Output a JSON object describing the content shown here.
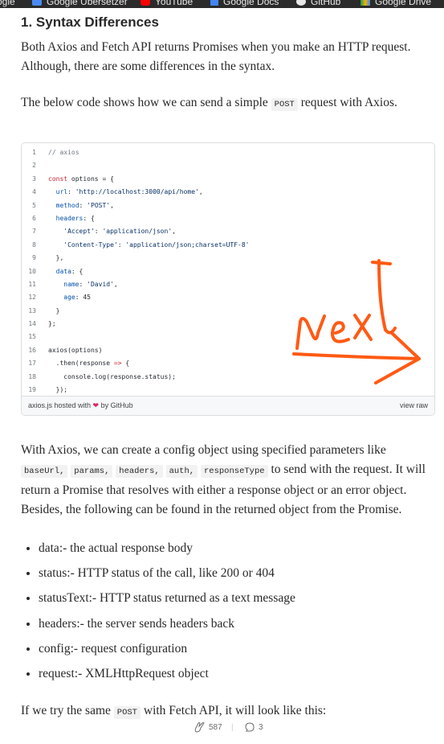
{
  "bookmarks": [
    {
      "label": "ogle",
      "icon": "none"
    },
    {
      "label": "Google Übersetzer",
      "icon": "google-translate-icon"
    },
    {
      "label": "YouTube",
      "icon": "youtube-icon"
    },
    {
      "label": "Google Docs",
      "icon": "google-docs-icon"
    },
    {
      "label": "GitHub",
      "icon": "github-icon"
    },
    {
      "label": "Google Drive",
      "icon": "google-drive-icon"
    }
  ],
  "article": {
    "heading": "1. Syntax Differences",
    "p1": "Both Axios and Fetch API returns Promises when you make an HTTP request. Although, there are some differences in the syntax.",
    "p2_before": "The below code shows how we can send a simple ",
    "p2_code": "POST",
    "p2_after": " request with Axios.",
    "p3_a": "With Axios, we can create a config object using specified parameters like",
    "p3_codes": [
      "baseUrl,",
      "params,",
      "headers,",
      "auth,",
      "responseType"
    ],
    "p3_b": " to send with the request. It will return a Promise that resolves with either a response object or an error object. Besides, the following can be found in the returned object from the Promise.",
    "bullets": [
      "data:- the actual response body",
      "status:- HTTP status of the call, like 200 or 404",
      "statusText:- HTTP status returned as a text message",
      "headers:- the server sends headers back",
      "config:- request configuration",
      "request:- XMLHttpRequest object"
    ],
    "p4_before": "If we try the same ",
    "p4_code": "POST",
    "p4_after": " with Fetch API, it will look like this:"
  },
  "gist": {
    "lines": [
      "// axios",
      "",
      "const options = {",
      "  url: 'http://localhost:3000/api/home',",
      "  method: 'POST',",
      "  headers: {",
      "    'Accept': 'application/json',",
      "    'Content-Type': 'application/json;charset=UTF-8'",
      "  },",
      "  data: {",
      "    name: 'David',",
      "    age: 45",
      "  }",
      "};",
      "",
      "axios(options)",
      "  .then(response => {",
      "    console.log(response.status);",
      "  });"
    ],
    "footer_file": "axios.js",
    "footer_hosted": " hosted with ",
    "footer_by": " by GitHub",
    "footer_raw": "view raw"
  },
  "annotation": {
    "handwritten_text": "Next"
  },
  "footer": {
    "claps": "587",
    "responses": "3"
  },
  "colors": {
    "bookmarks_bg": "#2b2b2b",
    "annotation": "#ff5a14"
  }
}
